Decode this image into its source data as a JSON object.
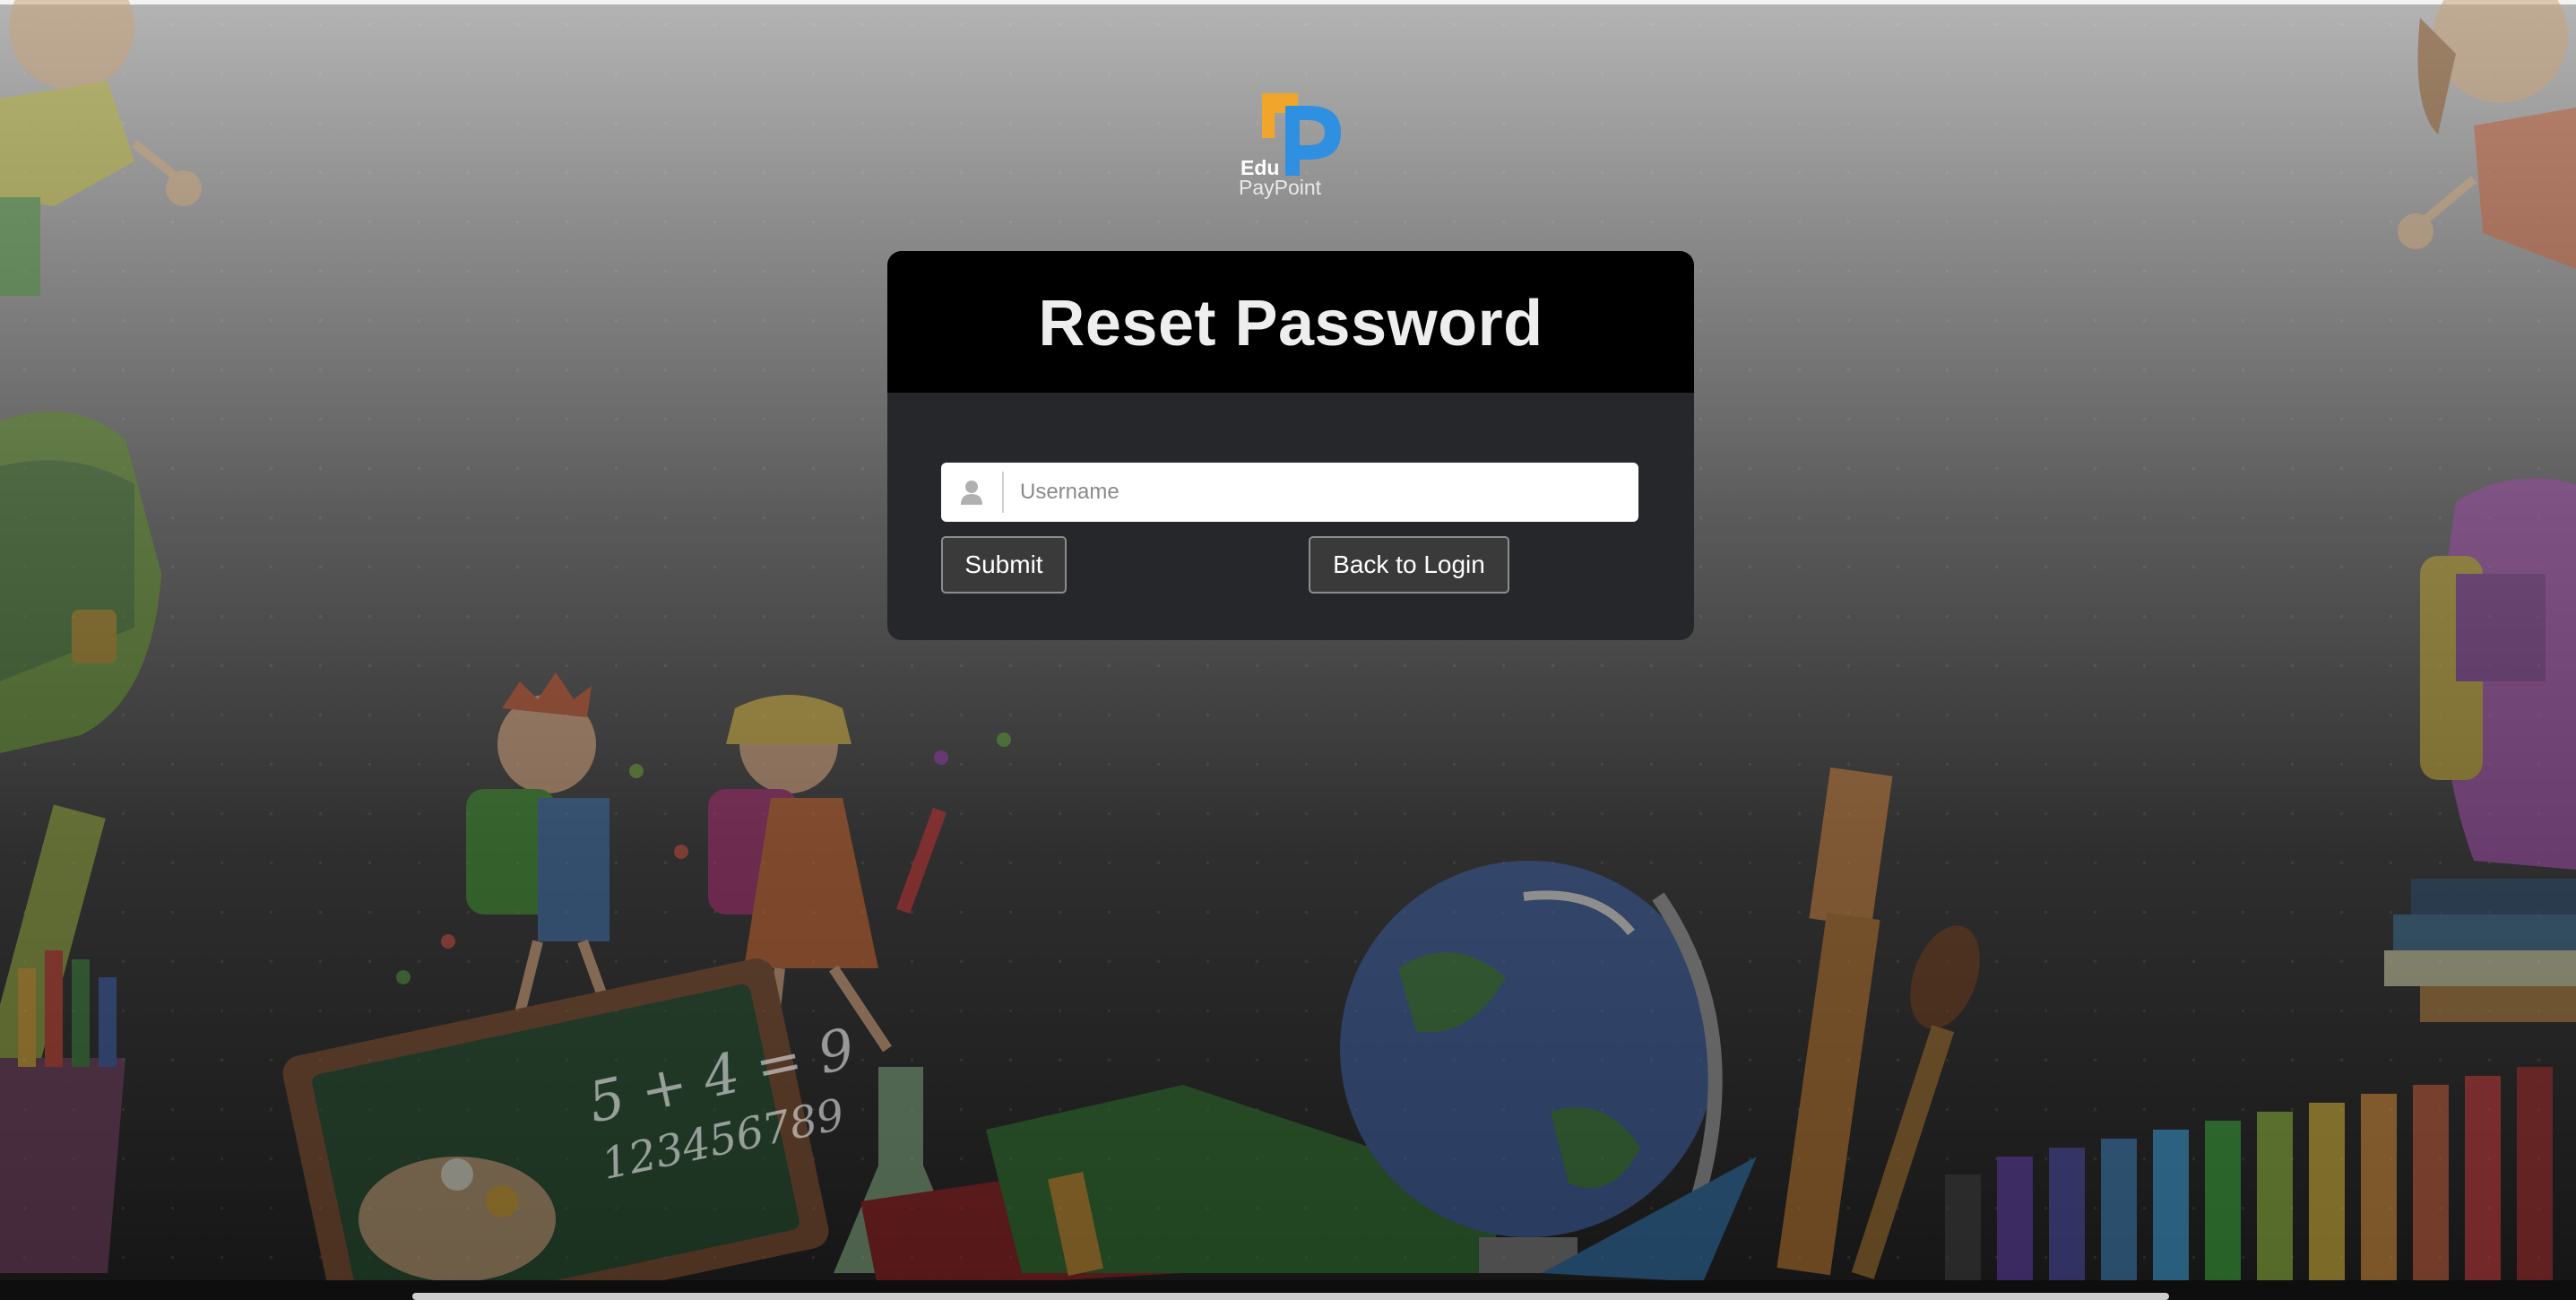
{
  "logo": {
    "line1": "Edu",
    "line2": "PayPoint"
  },
  "card": {
    "title": "Reset Password"
  },
  "form": {
    "username_placeholder": "Username",
    "username_value": "",
    "user_icon": "user-icon",
    "submit_label": "Submit",
    "back_label": "Back to Login"
  },
  "chalkboard": {
    "line1": "5 + 4 = 9",
    "line2": "123456789"
  },
  "colors": {
    "card_header": "#000000",
    "card_body": "#25272b",
    "button_bg": "#3a3a3a",
    "logo_orange": "#f5a623",
    "logo_blue": "#2f8fe0"
  }
}
